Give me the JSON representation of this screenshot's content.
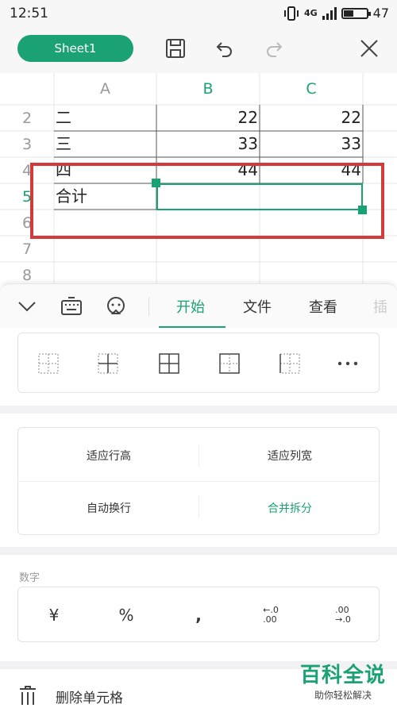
{
  "status_bar": {
    "time": "12:51",
    "signal": "4G",
    "battery": "47",
    "battery_level": 0.47
  },
  "toolbar": {
    "sheet_name": "Sheet1"
  },
  "grid": {
    "columns": [
      "A",
      "B",
      "C"
    ],
    "rows": [
      {
        "num": "2",
        "a": "二",
        "b": "22",
        "c": "22"
      },
      {
        "num": "3",
        "a": "三",
        "b": "33",
        "c": "33"
      },
      {
        "num": "4",
        "a": "四",
        "b": "44",
        "c": "44"
      },
      {
        "num": "5",
        "a": "合计",
        "b": "",
        "c": ""
      },
      {
        "num": "6",
        "a": "",
        "b": "",
        "c": ""
      },
      {
        "num": "7",
        "a": "",
        "b": "",
        "c": ""
      },
      {
        "num": "8",
        "a": "",
        "b": "",
        "c": ""
      }
    ]
  },
  "ribbon_tabs": [
    "开始",
    "文件",
    "查看",
    "插"
  ],
  "cell_actions": {
    "row_height": "适应行高",
    "col_width": "适应列宽",
    "wrap": "自动换行",
    "merge": "合并拆分"
  },
  "number_section": {
    "label": "数字",
    "buttons": [
      "¥",
      "%",
      ",",
      "←.0\n.00",
      ".00\n→.0"
    ]
  },
  "delete_cell": "删除单元格",
  "watermark": {
    "title": "百科全说",
    "subtitle": "助你轻松解决"
  },
  "colors": {
    "accent": "#1aa174",
    "highlight": "#d13b3b"
  }
}
